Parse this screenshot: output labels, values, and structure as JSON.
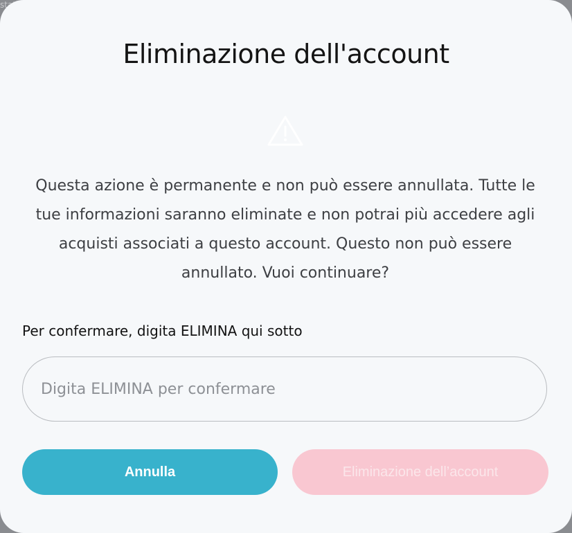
{
  "background": {
    "peek_text": "stat"
  },
  "dialog": {
    "title": "Eliminazione dell'account",
    "icon": "warning-triangle-icon",
    "message": "Questa azione è permanente e non può essere annullata. Tutte le tue informazioni saranno eliminate e non potrai più accedere agli acquisti associati a questo account. Questo non può essere annullato. Vuoi continuare?",
    "confirm_label": "Per confermare, digita ELIMINA qui sotto",
    "input": {
      "value": "",
      "placeholder": "Digita ELIMINA per confermare"
    },
    "cancel_label": "Annulla",
    "delete_label": "Eliminazione dell’account",
    "colors": {
      "cancel_button": "#38b2cc",
      "delete_button_disabled": "#f9c7d1",
      "modal_background": "#f6f8fa"
    }
  }
}
